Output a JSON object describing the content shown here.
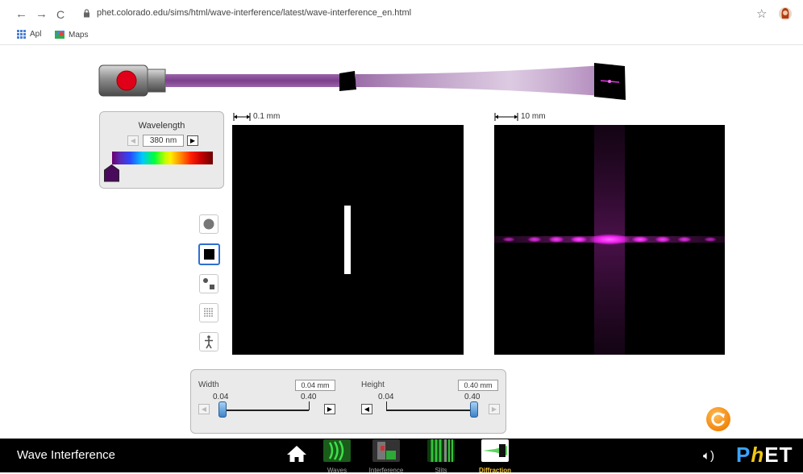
{
  "browser": {
    "url": "phet.colorado.edu/sims/html/wave-interference/latest/wave-interference_en.html",
    "bookmarks": [
      {
        "label": "Apl",
        "icon": "apps-grid-icon"
      },
      {
        "label": "Maps",
        "icon": "maps-icon"
      }
    ]
  },
  "wavelength": {
    "title": "Wavelength",
    "value": "380 nm"
  },
  "aperture_screen": {
    "scale": "0.1 mm"
  },
  "pattern_screen": {
    "scale": "10 mm"
  },
  "width_control": {
    "title": "Width",
    "value": "0.04 mm",
    "min_label": "0.04",
    "max_label": "0.40",
    "level": 0.0
  },
  "height_control": {
    "title": "Height",
    "value": "0.40 mm",
    "min_label": "0.04",
    "max_label": "0.40",
    "level": 1.0
  },
  "navbar": {
    "title": "Wave Interference",
    "screens": [
      {
        "label": "Waves",
        "icon": "waves-screen-icon",
        "selected": false
      },
      {
        "label": "Interference",
        "icon": "interference-screen-icon",
        "selected": false
      },
      {
        "label": "Slits",
        "icon": "slits-screen-icon",
        "selected": false
      },
      {
        "label": "Diffraction",
        "icon": "diffraction-screen-icon",
        "selected": true
      }
    ],
    "brand": "PhET"
  },
  "colors": {
    "beam": "#8a4f9a",
    "pattern": "#ff33ff",
    "accent_selected": "#2e6fd0",
    "tab_selected": "#f6c431"
  }
}
